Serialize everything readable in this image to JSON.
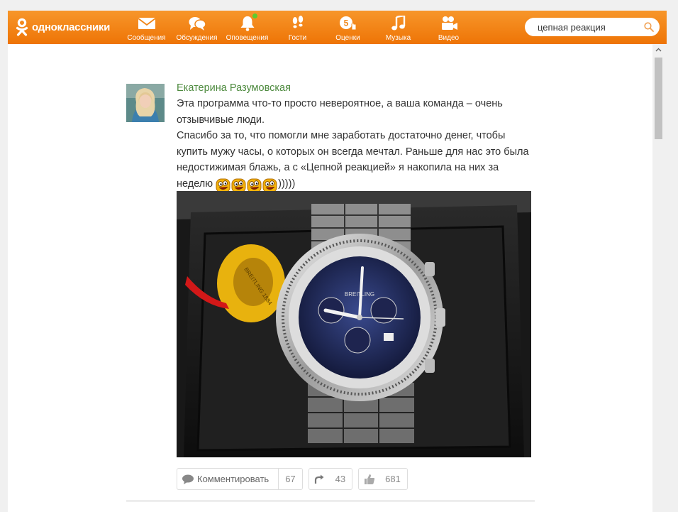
{
  "app": {
    "logo_text": "одноклассники"
  },
  "nav": [
    {
      "label": "Сообщения",
      "icon": "envelope-icon"
    },
    {
      "label": "Обсуждения",
      "icon": "chat-bubbles-icon"
    },
    {
      "label": "Оповещения",
      "icon": "bell-icon",
      "has_new": true
    },
    {
      "label": "Гости",
      "icon": "footprints-icon"
    },
    {
      "label": "Оценки",
      "icon": "rating-five-icon",
      "badge": "5"
    },
    {
      "label": "Музыка",
      "icon": "music-note-icon"
    },
    {
      "label": "Видео",
      "icon": "video-camera-icon"
    }
  ],
  "search": {
    "value": "цепная реакция",
    "icon": "search-icon"
  },
  "post": {
    "author": "Екатерина Разумовская",
    "paragraph1": "Эта программа что-то просто невероятное, а ваша команда – очень отзывчивые люди.",
    "paragraph2": "Спасибо за то, что помогли мне заработать достаточно денег, чтобы купить мужу часы, о которых он всегда мечтал. Раньше для нас это была недостижимая блажь, а с «Цепной реакцией» я накопила на них за неделю",
    "emoji_count": 4,
    "trailing": ")))))",
    "photo_alt": "watch-photo",
    "watch_dial_text": "BREITLING",
    "medal_text": "BREITLING 1884"
  },
  "actions": {
    "comment_label": "Комментировать",
    "comment_count": "67",
    "share_count": "43",
    "like_count": "681"
  },
  "colors": {
    "brand_orange": "#ee8208",
    "author_green": "#4d8a3e",
    "online_dot": "#5dcc2e"
  }
}
